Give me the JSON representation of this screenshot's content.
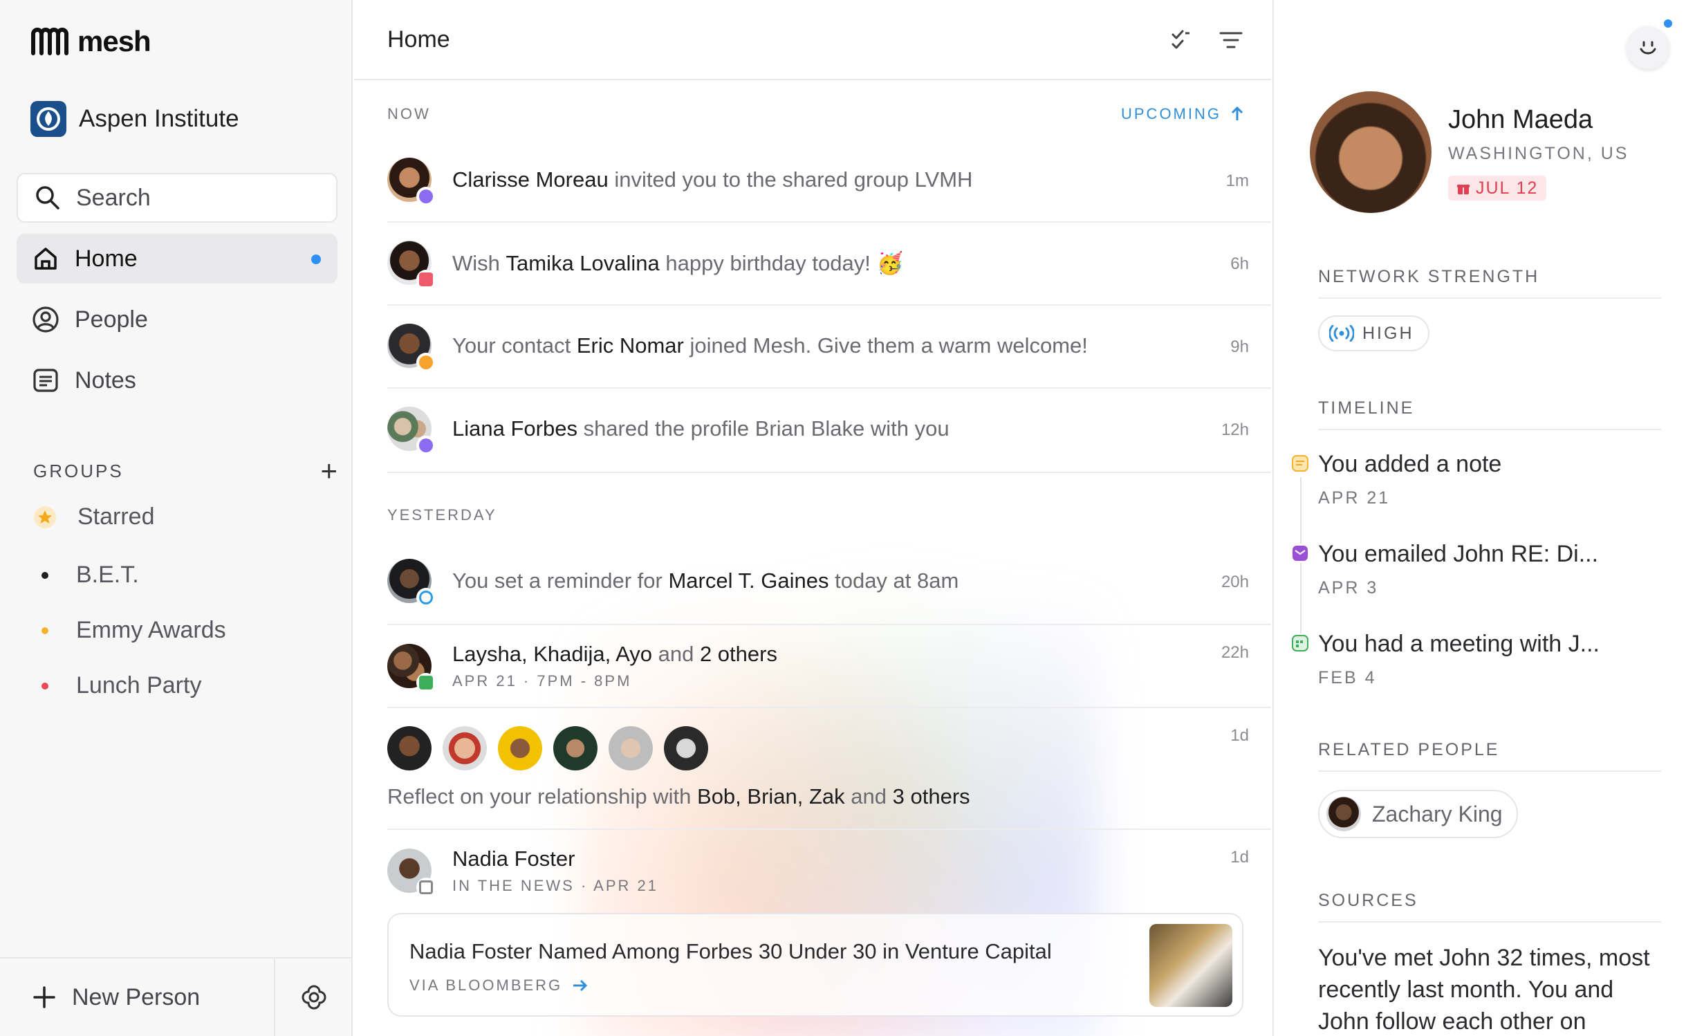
{
  "app": {
    "logo_text": "mesh"
  },
  "sidebar": {
    "org_name": "Aspen Institute",
    "search_label": "Search",
    "nav": [
      {
        "label": "Home",
        "icon": "home-icon",
        "active": true,
        "unread": true
      },
      {
        "label": "People",
        "icon": "person-icon"
      },
      {
        "label": "Notes",
        "icon": "notes-icon"
      }
    ],
    "groups_title": "GROUPS",
    "groups_add": "+",
    "groups": [
      {
        "label": "Starred",
        "icon": "star-icon",
        "color": "#f4b22e"
      },
      {
        "label": "B.E.T.",
        "color": "#1f1f22"
      },
      {
        "label": "Emmy Awards",
        "color": "#f4b22e"
      },
      {
        "label": "Lunch Party",
        "color": "#e94a57"
      }
    ],
    "new_person_label": "New Person"
  },
  "main": {
    "title": "Home",
    "now_label": "NOW",
    "upcoming_label": "UPCOMING",
    "yesterday_label": "YESTERDAY",
    "rows": [
      {
        "pre": "",
        "name": "Clarisse Moreau",
        "post": " invited you to the shared group LVMH",
        "time": "1m"
      },
      {
        "pre": "Wish ",
        "name": "Tamika Lovalina",
        "post": " happy birthday today! 🥳",
        "time": "6h"
      },
      {
        "pre": "Your contact ",
        "name": "Eric Nomar",
        "post": " joined Mesh. Give them a warm welcome!",
        "time": "9h"
      },
      {
        "pre": "",
        "name": "Liana Forbes",
        "post": " shared the profile Brian Blake with you",
        "time": "12h"
      },
      {
        "pre": "You set a reminder for ",
        "name": "Marcel T. Gaines",
        "post": " today at 8am",
        "time": "20h"
      },
      {
        "pre": "",
        "name": "Laysha, Khadija, Ayo",
        "mid": " and ",
        "name2": "2 others",
        "sub": "APR 21 · 7PM - 8PM",
        "time": "22h"
      },
      {
        "pre": "Reflect on your relationship with ",
        "name": "Bob, Brian, Zak",
        "mid": " and ",
        "name2": "3 others",
        "time": "1d"
      },
      {
        "name": "Nadia Foster",
        "sub": "IN THE NEWS · APR 21",
        "time": "1d"
      }
    ],
    "news": {
      "title": "Nadia Foster Named Among Forbes 30 Under 30 in Venture Capital",
      "via": "VIA BLOOMBERG"
    }
  },
  "panel": {
    "name": "John Maeda",
    "location": "WASHINGTON, US",
    "birthday": "JUL 12",
    "network_title": "NETWORK STRENGTH",
    "network_value": "HIGH",
    "timeline_title": "TIMELINE",
    "timeline": [
      {
        "title": "You added a note",
        "date": "APR 21",
        "icon": "note-icon",
        "color": "#f4b22e"
      },
      {
        "title": "You emailed John RE: Di...",
        "date": "APR 3",
        "icon": "mail-icon",
        "color": "#9b4fd6"
      },
      {
        "title": "You had a meeting with J...",
        "date": "FEB 4",
        "icon": "calendar-icon",
        "color": "#3fae5a"
      }
    ],
    "related_title": "RELATED PEOPLE",
    "related": [
      {
        "name": "Zachary King"
      }
    ],
    "sources_title": "SOURCES",
    "sources_text": "You've met John 32 times, most recently last month. You and John follow each other on"
  }
}
